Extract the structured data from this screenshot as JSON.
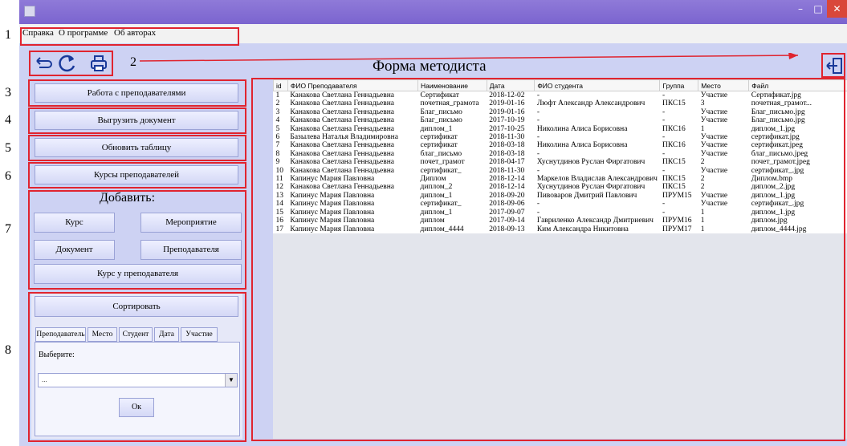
{
  "markers": [
    "1",
    "2",
    "3",
    "4",
    "5",
    "6",
    "7",
    "8"
  ],
  "window": {
    "min_label": "–",
    "max_label": "□",
    "close_label": "✕"
  },
  "menu": [
    "Справка",
    "О программе",
    "Об авторах"
  ],
  "toolbar": {
    "back_icon": "↩",
    "refresh_icon": "↻",
    "print_icon": "⎙"
  },
  "form_title": "Форма методиста",
  "exit_icon": "⇦",
  "buttons": {
    "teachers": "Работа с преподавателями",
    "export": "Выгрузить документ",
    "refresh_table": "Обновить таблицу",
    "courses": "Курсы преподавателей"
  },
  "add": {
    "title": "Добавить:",
    "course": "Курс",
    "event": "Мероприятие",
    "document": "Документ",
    "teacher": "Преподавателя",
    "course_to_teacher": "Курс у преподавателя"
  },
  "sort": {
    "button": "Сортировать",
    "tabs": [
      "Преподаватель",
      "Место",
      "Студент",
      "Дата",
      "Участие"
    ],
    "choose_label": "Выберите:",
    "select_value": "...",
    "ok": "Ок"
  },
  "table": {
    "columns": [
      "id",
      "ФИО Преподавателя",
      "Наименование",
      "Дата",
      "ФИО студента",
      "Группа",
      "Место",
      "Файл"
    ],
    "rows": [
      [
        "1",
        "Канакова Светлана Геннадьевна",
        "Сертификат",
        "2018-12-02",
        "-",
        "-",
        "Участие",
        "Сертификат.jpg"
      ],
      [
        "2",
        "Канакова Светлана Геннадьевна",
        "почетная_грамота",
        "2019-01-16",
        "Люфт Александр Александрович",
        "ПКС15",
        "3",
        "почетная_грамот..."
      ],
      [
        "3",
        "Канакова Светлана Геннадьевна",
        "Благ_письмо",
        "2019-01-16",
        "-",
        "-",
        "Участие",
        "Благ_письмо.jpg"
      ],
      [
        "4",
        "Канакова Светлана Геннадьевна",
        "Благ_письмо",
        "2017-10-19",
        "-",
        "-",
        "Участие",
        "Благ_письмо.jpg"
      ],
      [
        "5",
        "Канакова Светлана Геннадьевна",
        "диплом_1",
        "2017-10-25",
        "Николина Алиса Борисовна",
        "ПКС16",
        "1",
        "диплом_1.jpg"
      ],
      [
        "6",
        "Базылева Наталья Владимировна",
        "сертификат",
        "2018-11-30",
        "-",
        "-",
        "Участие",
        "сертификат.jpg"
      ],
      [
        "7",
        "Канакова Светлана Геннадьевна",
        "сертификат",
        "2018-03-18",
        "Николина Алиса Борисовна",
        "ПКС16",
        "Участие",
        "сертификат.jpeg"
      ],
      [
        "8",
        "Канакова Светлана Геннадьевна",
        "благ_письмо",
        "2018-03-18",
        "-",
        "-",
        "Участие",
        "благ_письмо.jpeg"
      ],
      [
        "9",
        "Канакова Светлана Геннадьевна",
        "почет_грамот",
        "2018-04-17",
        "Хуснутдинов Руслан Фиргатович",
        "ПКС15",
        "2",
        "почет_грамот.jpeg"
      ],
      [
        "10",
        "Канакова Светлана Геннадьевна",
        "сертификат_",
        "2018-11-30",
        "-",
        "-",
        "Участие",
        "сертификат_.jpg"
      ],
      [
        "11",
        "Капинус Мария Павловна",
        "Диплом",
        "2018-12-14",
        "Маркелов Владислав Александрович",
        "ПКС15",
        "2",
        "Диплом.bmp"
      ],
      [
        "12",
        "Канакова Светлана Геннадьевна",
        "диплом_2",
        "2018-12-14",
        "Хуснутдинов Руслан Фиргатович",
        "ПКС15",
        "2",
        "диплом_2.jpg"
      ],
      [
        "13",
        "Капинус Мария Павловна",
        "диплом_1",
        "2018-09-20",
        "Пивоваров Дмитрий Павлович",
        "ПРУМ15",
        "Участие",
        "диплом_1.jpg"
      ],
      [
        "14",
        "Капинус Мария Павловна",
        "сертификат_",
        "2018-09-06",
        "-",
        "-",
        "Участие",
        "сертификат_.jpg"
      ],
      [
        "15",
        "Капинус Мария Павловна",
        "диплом_1",
        "2017-09-07",
        "-",
        "-",
        "1",
        "диплом_1.jpg"
      ],
      [
        "16",
        "Капинус Мария Павловна",
        "диплом",
        "2017-09-14",
        "Гавриленко Александр Дмитриевич",
        "ПРУМ16",
        "1",
        "диплом.jpg"
      ],
      [
        "17",
        "Капинус Мария Павловна",
        "диплом_4444",
        "2018-09-13",
        "Ким Александра Никитовна",
        "ПРУМ17",
        "1",
        "диплом_4444.jpg"
      ]
    ]
  }
}
